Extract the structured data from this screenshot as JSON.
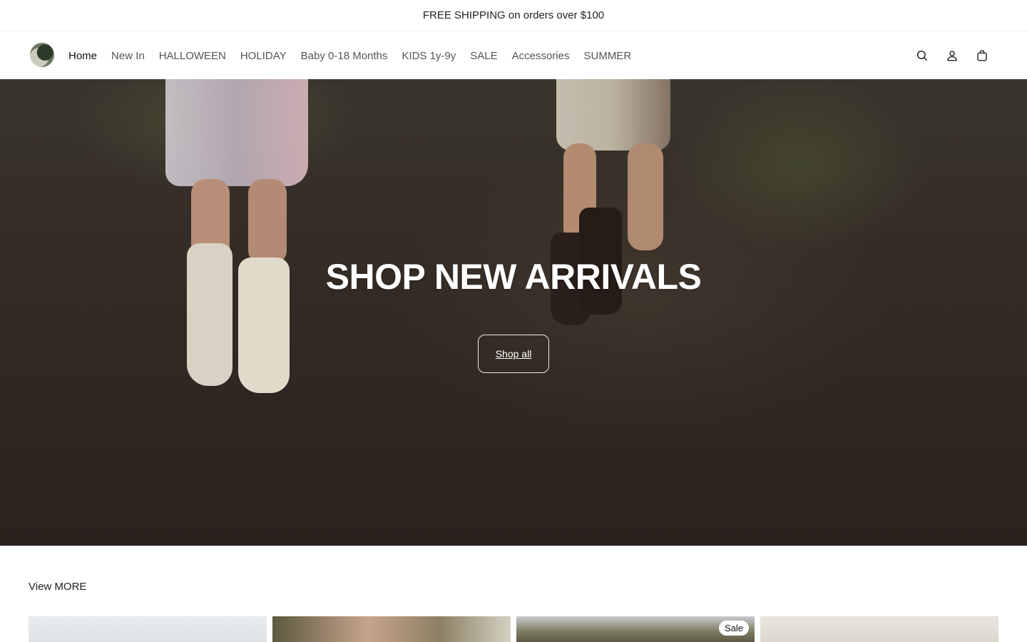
{
  "announcement": {
    "text": "FREE SHIPPING on orders over $100"
  },
  "header": {
    "logo_icon": "brand-logo-icon",
    "nav": [
      {
        "label": "Home",
        "active": true
      },
      {
        "label": "New In"
      },
      {
        "label": "HALLOWEEN"
      },
      {
        "label": "HOLIDAY"
      },
      {
        "label": "Baby 0-18 Months"
      },
      {
        "label": "KIDS 1y-9y"
      },
      {
        "label": "SALE"
      },
      {
        "label": "Accessories"
      },
      {
        "label": "SUMMER"
      }
    ],
    "icons": [
      "search-icon",
      "account-icon",
      "cart-icon"
    ]
  },
  "hero": {
    "title": "SHOP NEW ARRIVALS",
    "button_label": "Shop all"
  },
  "section": {
    "link_label": "View MORE"
  },
  "products": {
    "badges": [
      "",
      "",
      "Sale",
      ""
    ]
  },
  "colors": {
    "text": "#222222",
    "white": "#ffffff"
  }
}
